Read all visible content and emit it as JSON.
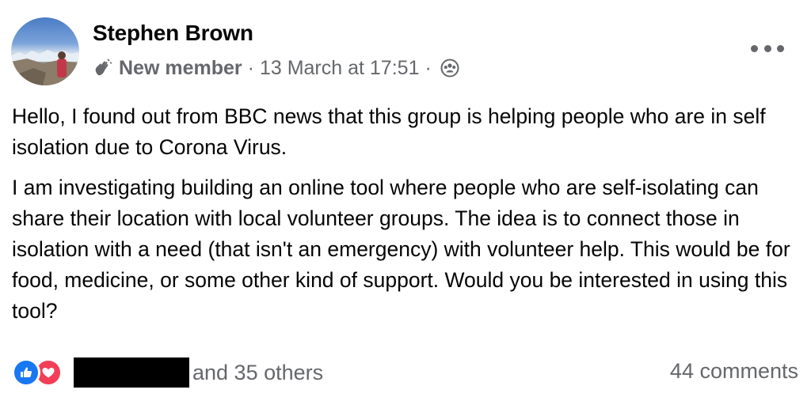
{
  "author": {
    "name": "Stephen Brown",
    "badge": "New member",
    "timestamp": "13 March at 17:51",
    "separator": "·",
    "badge_icon": "waving-hand-icon",
    "privacy_icon": "group-audience-icon"
  },
  "post": {
    "paragraphs": [
      "Hello, I found out from BBC news that this group is helping people who are in self isolation due to Corona Virus.",
      "I am investigating building an online tool where people who are self-isolating can share their location with local volunteer groups. The idea is to connect those in isolation with a need (that isn't an emergency) with volunteer help. This would be for food, medicine, or some other kind of support. Would you be interested in using this tool?"
    ]
  },
  "footer": {
    "reactions": [
      "like-icon",
      "love-icon"
    ],
    "others_text": "and 35 others",
    "comments_text": "44 comments"
  },
  "colors": {
    "like": "#1877f2",
    "love": "#f33e58",
    "secondary_text": "#65676b"
  }
}
